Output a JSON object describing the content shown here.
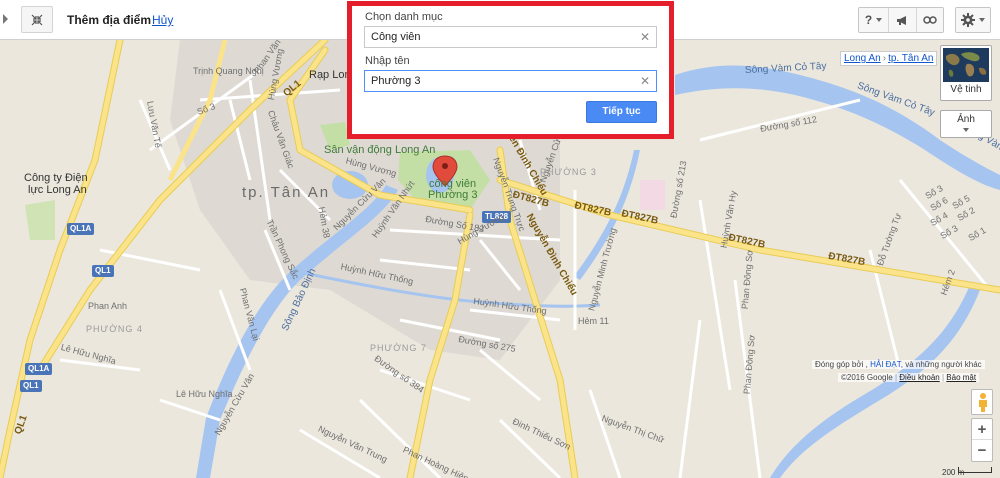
{
  "toolbar": {
    "collapse_icon": "collapse-icon",
    "title": "Thêm địa điểm",
    "cancel_label": "Hủy",
    "help_label": "?",
    "settings_icon": "gear-icon"
  },
  "dialog": {
    "category_label": "Chọn danh mục",
    "category_value": "Công viên",
    "name_label": "Nhập tên",
    "name_value": "Phường 3",
    "clear_glyph": "✕",
    "submit_label": "Tiếp tục",
    "highlight_color": "#e41f2b"
  },
  "breadcrumb": {
    "region": "Long An",
    "city": "tp. Tân An",
    "separator": "›"
  },
  "layers": {
    "satellite_label": "Vệ tinh",
    "photos_label": "Ảnh"
  },
  "attribution": {
    "prefix": "Đóng góp bởi ,",
    "contributor": "HẢI ĐẠT,",
    "suffix": "và những người khác",
    "copyright": "©2016 Google",
    "terms": "Điều khoản",
    "privacy": "Bảo mật"
  },
  "zoom": {
    "in": "+",
    "out": "−"
  },
  "scale": "200 m",
  "map_labels": {
    "trinh_quang_nghi": "Trịnh Quang Nghị",
    "phan_van_tao": "Phan Văn Tạo",
    "rap_long": "Rạp Long",
    "hung_vuong_top": "Hùng Vương",
    "luu_van_te": "Lưu Văn Tế",
    "so3_a": "Số 3",
    "chau_van_giac": "Châu Văn Giác",
    "ql1_a": "QL1",
    "san_van_dong": "Sân vận động Long An",
    "cong_ty": "Công ty Điện",
    "cong_ty2": "lực Long An",
    "ql1a_badge": "QL1A",
    "ql1_badge": "QL1",
    "tp_tan_an": "tp. Tân An",
    "hung_vuong_mid": "Hùng Vương",
    "nguyen_cuu_van": "Nguyễn Cửu Vân",
    "huynh_van_nhut": "Huỳnh Văn Nhứt",
    "hem38": "Hẻm 38",
    "tran_phong_sac": "Trần Phong Sắc",
    "cong_vien": "công viên",
    "phuong3_park": "Phường 3",
    "nguyen_dinh_chieu_top": "Nguyễn Đình Chiểu",
    "nguyen_trung_truc": "Nguyễn Trung Trực",
    "nguyen_cuu_van_right": "Nguyễn Cửu Vân",
    "phuong3": "PHƯỜNG 3",
    "tl828": "TL828",
    "dt827b_a": "ĐT827B",
    "dt827b_b": "ĐT827B",
    "dt827b_c": "ĐT827B",
    "dt827b_d": "ĐT827B",
    "dt827b_e": "ĐT827B",
    "duong_so_182": "Đường Số 182",
    "hung_vuong_low": "Hùng Vương",
    "nguyen_dinh_chieu": "Nguyễn Đình Chiểu",
    "nguyen_minh_truong": "Nguyễn Minh Trường",
    "duong_so_213": "Đường số 213",
    "duong_so_112": "Đường số 112",
    "huynh_van_hy": "Huỳnh Văn Hy",
    "do_tuong_tu": "Đỗ Tường Tự",
    "phan_dong_so": "Phan Đông Sơ",
    "song_vam_co_tay_a": "Sông Vàm Cỏ Tây",
    "song_vam_co_tay_b": "Sông Vàm Cỏ Tây",
    "song_vam_co_tay_c": "Sông Vàm Cỏ Tây",
    "huynh_huu_thong": "Huỳnh Hữu Thống",
    "huynh_huu_thong_b": "Huỳnh Hữu Thống",
    "song_bao_dinh": "Sông Bảo Định",
    "phan_anh": "Phan Anh",
    "phuong4": "PHƯỜNG 4",
    "phan_van_lai": "Phan Văn Lại",
    "le_huu_nghia": "Lê Hữu Nghĩa",
    "le_huu_nghia_b": "Lê Hữu Nghĩa",
    "ql1a_badge_b": "QL1A",
    "ql1_badge_b": "QL1",
    "ql1_badge_c": "QL1",
    "phuong7": "PHƯỜNG 7",
    "duong_so_275": "Đường số 275",
    "duong_so_384": "Đường số 384",
    "hem11": "Hẻm 11",
    "nguyen_cuu_van_low": "Nguyễn Cửu Vân",
    "nguyen_van_trung": "Nguyễn Văn Trung",
    "phan_hoang_hien": "Phan Hoàng Hiên",
    "dinh_thieu_son": "Đinh Thiếu Sơn",
    "nguyen_thi_chu": "Nguyễn Thị Chữ",
    "phan_dong_so_b": "Phan Đông Sơ",
    "so3_b": "Số 3",
    "so6": "Số 6",
    "so5": "Số 5",
    "so2": "Số 2",
    "so4": "Số 4",
    "so3_c": "Số 3",
    "so1": "Số 1",
    "hem2": "Hẻm 2"
  },
  "colors": {
    "river": "#a5c4f0",
    "highway": "#fbe38a",
    "road": "#ffffff",
    "park": "#c4dfa5",
    "city": "#dedad3",
    "accent_button": "#4a8af4",
    "marker": "#e04b3c"
  }
}
